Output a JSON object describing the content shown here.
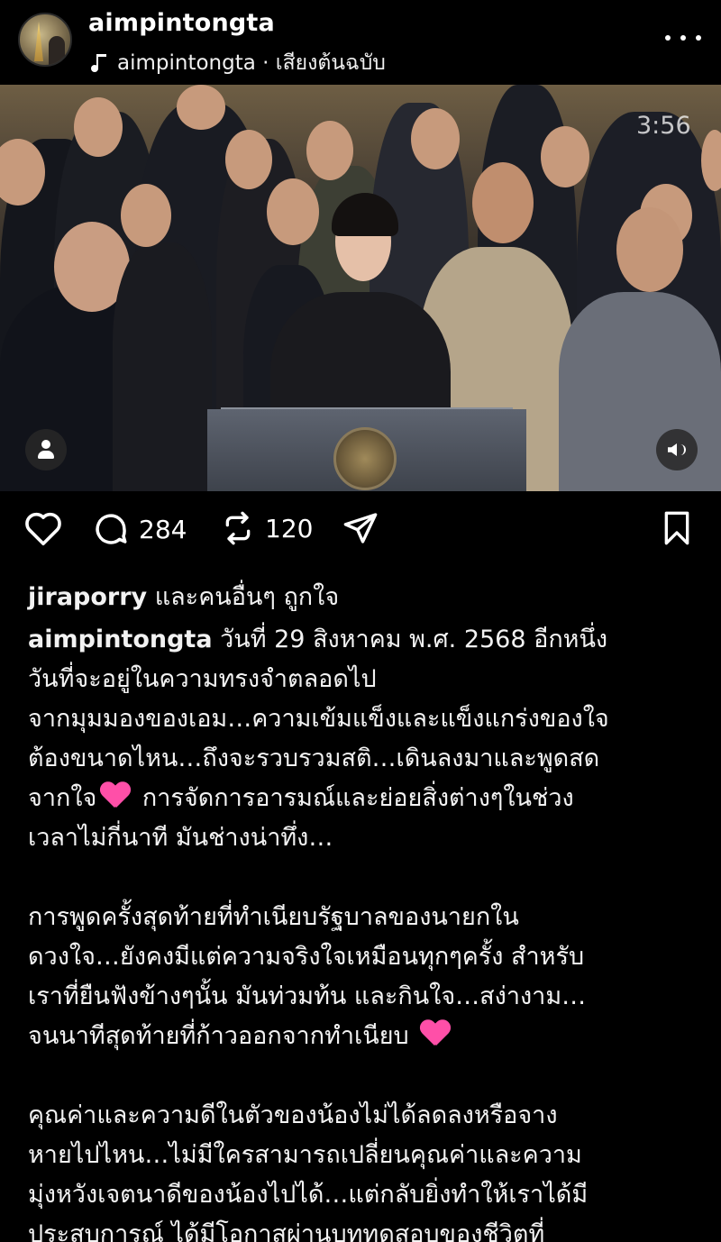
{
  "header": {
    "username": "aimpintongta",
    "audio_label": "aimpintongta · เสียงต้นฉบับ",
    "icons": {
      "audio": "music-note-icon",
      "more": "more-horizontal-icon"
    }
  },
  "media": {
    "timer": "3:56",
    "icons": {
      "tag": "user-tag-icon",
      "sound": "speaker-icon"
    }
  },
  "actions": {
    "comment_count": "284",
    "repost_count": "120",
    "icons": [
      "heart-icon",
      "comment-icon",
      "repost-icon",
      "share-icon",
      "bookmark-icon"
    ]
  },
  "likes": {
    "user": "jiraporry",
    "text": " และคนอื่นๆ ถูกใจ"
  },
  "caption": {
    "author": "aimpintongta",
    "line1": " วันที่ 29 สิงหาคม พ.ศ. 2568 อีกหนึ่ง",
    "para1": "วันที่จะอยู่ในความทรงจำตลอดไป\nจากมุมมองของเอม…ความเข้มแข็งและแข็งแกร่งของใจ\nต้องขนาดไหน…ถึงจะรวบรวมสติ…เดินลงมาและพูดสด\nจากใจ",
    "para1b": " การจัดการอารมณ์และย่อยสิ่งต่างๆในช่วง\nเวลาไม่กี่นาที มันช่างน่าทึ่ง…\n\nการพูดครั้งสุดท้ายที่ทำเนียบรัฐบาลของนายกใน\nดวงใจ…ยังคงมีแต่ความจริงใจเหมือนทุกๆครั้ง สำหรับ\nเราที่ยืนฟังข้างๆนั้น มันท่วมท้น และกินใจ…สง่างาม…\nจนนาทีสุดท้ายที่ก้าวออกจากทำเนียบ",
    "para2": "\n\nคุณค่าและความดีในตัวของน้องไม่ได้ลดลงหรือจาง\nหายไปไหน…ไม่มีใครสามารถเปลี่ยนคุณค่าและความ\nมุ่งหวังเจตนาดีของน้องไปได้…แต่กลับยิ่งทำให้เราได้มี\nประสบการณ์ ได้มีโอกาสผ่านบททดสอบของชีวิตที่",
    "emoji": "pink-heart-icon"
  }
}
